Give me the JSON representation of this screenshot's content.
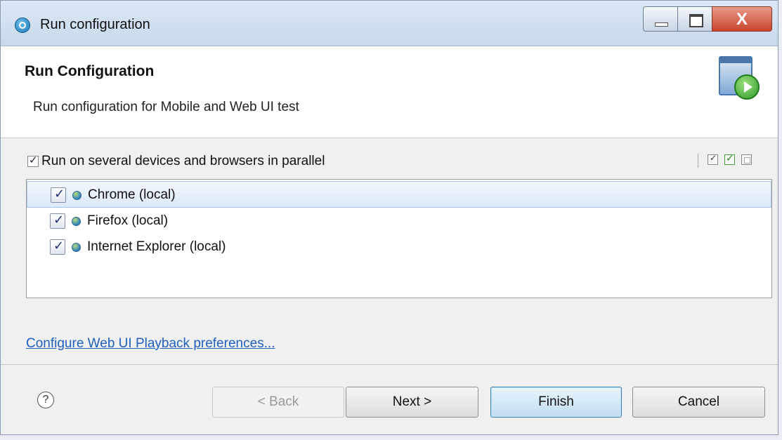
{
  "window": {
    "title": "Run configuration",
    "controls": {
      "minimize": "—",
      "maximize": "□",
      "close": "X"
    }
  },
  "header": {
    "title": "Run Configuration",
    "description": "Run configuration for Mobile and Web UI test",
    "icon": "run-configuration-icon"
  },
  "parallel": {
    "label": "Run on several devices and browsers in parallel",
    "checked": true
  },
  "toolbar_icons": [
    "select-all-icon",
    "check-all-icon",
    "deselect-all-icon"
  ],
  "browsers": [
    {
      "label": "Chrome (local)",
      "checked": true,
      "selected": true
    },
    {
      "label": "Firefox (local)",
      "checked": true,
      "selected": false
    },
    {
      "label": "Internet Explorer (local)",
      "checked": true,
      "selected": false
    }
  ],
  "preferences_link": "Configure Web UI Playback preferences...",
  "footer": {
    "help": "?",
    "back": "< Back",
    "next": "Next >",
    "finish": "Finish",
    "cancel": "Cancel"
  }
}
